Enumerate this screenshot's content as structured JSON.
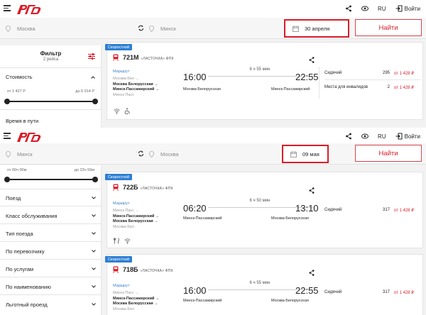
{
  "colors": {
    "brand": "#d81e2a",
    "accent": "#2f7fd3",
    "link": "#3a7fd0"
  },
  "header": {
    "logo_icon": "rzd-logo",
    "lang": "RU",
    "login": "Войти"
  },
  "screen_a": {
    "search": {
      "from": "Москва",
      "to": "Минск",
      "date": "30 апреля",
      "find_label": "Найти"
    },
    "filter": {
      "title": "Фильтр",
      "subtitle": "2 рейса",
      "cost_label": "Стоимость",
      "cost_from": "от 1 427 Р",
      "cost_to": "до 6 014 Р",
      "travel_time_label": "Время в пути"
    },
    "train": {
      "badge": "Скоростной",
      "number": "721М",
      "brand": "«ЛАСТОЧКА» ФПК",
      "route_head": "Маршрут",
      "route": [
        "Москва Бел →",
        "Москва Белорусская →",
        "Минск-Пассажирский →",
        "Минск Пасс"
      ],
      "duration": "6 ч 55 мин",
      "dep_time": "16:00",
      "arr_time": "22:55",
      "dep_station": "Москва Белорусская",
      "arr_station": "Минск-Пассажирский",
      "classes": [
        {
          "name": "Сидячий",
          "count": "295",
          "price": "от 1 428 ₽"
        },
        {
          "name": "Места для инвалидов",
          "count": "2",
          "price": "от 1 428 ₽"
        }
      ]
    }
  },
  "screen_b": {
    "search": {
      "from": "Минск",
      "to": "Москва",
      "date": "09 мая",
      "find_label": "Найти"
    },
    "filter": {
      "time_from": "от 00ч 00м",
      "time_to": "до 23ч 59м",
      "rows": [
        "Поезд",
        "Класс обслуживания",
        "Тип поезда",
        "По перевозчику",
        "По услугам",
        "По наименованию",
        "Льготный проезд"
      ]
    },
    "trains": [
      {
        "badge": "Скоростной",
        "number": "722Б",
        "brand": "«ЛАСТОЧКА» ФПК",
        "route_head": "Маршрут",
        "route": [
          "Минск Пасс →",
          "Минск-Пассажирский →",
          "Москва Белорусская →",
          "Москва Бел"
        ],
        "duration": "6 ч 50 мин",
        "dep_time": "06:20",
        "arr_time": "13:10",
        "dep_station": "Минск-Пассажирский",
        "arr_station": "Москва Белорусская",
        "classes": [
          {
            "name": "Сидячий",
            "count": "317",
            "price": "от 1 428 ₽"
          }
        ]
      },
      {
        "badge": "Скоростной",
        "number": "718Б",
        "brand": "«ЛАСТОЧКА» ФПК",
        "route_head": "Маршрут",
        "route": [
          "Минск Пасс →",
          "Минск-Пассажирский →",
          "Москва Белорусская →",
          "Москва Бел"
        ],
        "duration": "6 ч 55 мин",
        "dep_time": "16:00",
        "arr_time": "22:55",
        "dep_station": "Минск-Пассажирский",
        "arr_station": "Москва Белорусская",
        "classes": [
          {
            "name": "Сидячий",
            "count": "317",
            "price": "от 1 428 ₽"
          }
        ]
      }
    ]
  }
}
